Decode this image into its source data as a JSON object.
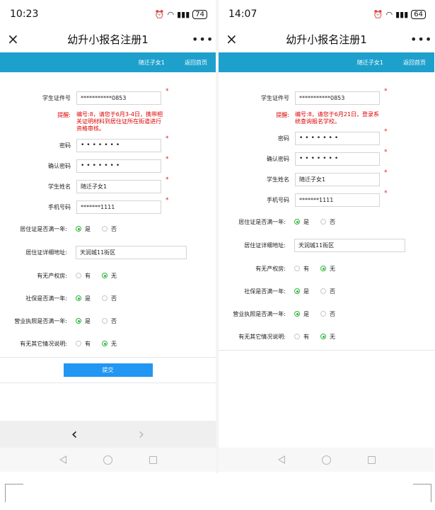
{
  "left": {
    "status": {
      "time": "10:23",
      "battery": "74"
    },
    "nav": {
      "close": "×",
      "title": "幼升小报名注册1",
      "more": "•••"
    },
    "band": {
      "child": "随迁子女1",
      "home": "返回首页"
    },
    "fields": {
      "cert_label": "学生证件号",
      "cert_value": "***********0853",
      "hint_label": "提醒:",
      "hint_text": "编号:8，请您于6月3-4日，携带相关证明材料到居住证所在街道进行资格审核。",
      "pwd_label": "密码",
      "pwd_value": "•••••••",
      "pwd2_label": "确认密码",
      "pwd2_value": "•••••••",
      "name_label": "学生姓名",
      "name_value": "随迁子女1",
      "phone_label": "手机号码",
      "phone_value": "*******1111",
      "star": "*"
    },
    "questions": [
      {
        "label": "居住证是否满一年:",
        "opt1": "是",
        "opt2": "否",
        "selected": 1
      },
      {
        "label": "居住证详细地址:",
        "value": "天润城11街区"
      },
      {
        "label": "有无产权房:",
        "opt1": "有",
        "opt2": "无",
        "selected": 2
      },
      {
        "label": "社保是否满一年:",
        "opt1": "是",
        "opt2": "否",
        "selected": 1
      },
      {
        "label": "营业执照是否满一年:",
        "opt1": "是",
        "opt2": "否",
        "selected": 1
      },
      {
        "label": "有无其它情况说明:",
        "opt1": "有",
        "opt2": "无",
        "selected": 2
      }
    ],
    "submit": "提交",
    "toolbar": {
      "back": "‹",
      "forward": "›"
    }
  },
  "right": {
    "status": {
      "time": "14:07",
      "battery": "64"
    },
    "nav": {
      "close": "×",
      "title": "幼升小报名注册1",
      "more": "•••"
    },
    "band": {
      "child": "随迁子女1",
      "home": "返回首页"
    },
    "fields": {
      "cert_label": "学生证件号",
      "cert_value": "***********0853",
      "hint_label": "提醒:",
      "hint_text": "编号:8，请您于6月21日，登录系统查询报名学校。",
      "pwd_label": "密码",
      "pwd_value": "•••••••",
      "pwd2_label": "确认密码",
      "pwd2_value": "•••••••",
      "name_label": "学生姓名",
      "name_value": "随迁子女1",
      "phone_label": "手机号码",
      "phone_value": "*******1111",
      "star": "*"
    },
    "questions": [
      {
        "label": "居住证是否满一年:",
        "opt1": "是",
        "opt2": "否",
        "selected": 1
      },
      {
        "label": "居住证详细地址:",
        "value": "天润城11街区"
      },
      {
        "label": "有无产权房:",
        "opt1": "有",
        "opt2": "无",
        "selected": 2
      },
      {
        "label": "社保是否满一年:",
        "opt1": "是",
        "opt2": "否",
        "selected": 1
      },
      {
        "label": "营业执照是否满一年:",
        "opt1": "是",
        "opt2": "否",
        "selected": 1
      },
      {
        "label": "有无其它情况说明:",
        "opt1": "有",
        "opt2": "无",
        "selected": 2
      }
    ]
  },
  "colors": {
    "band": "#1ea0cc",
    "submit": "#2196f3",
    "radio_selected": "#2db43c",
    "hint": "#dd0000"
  }
}
